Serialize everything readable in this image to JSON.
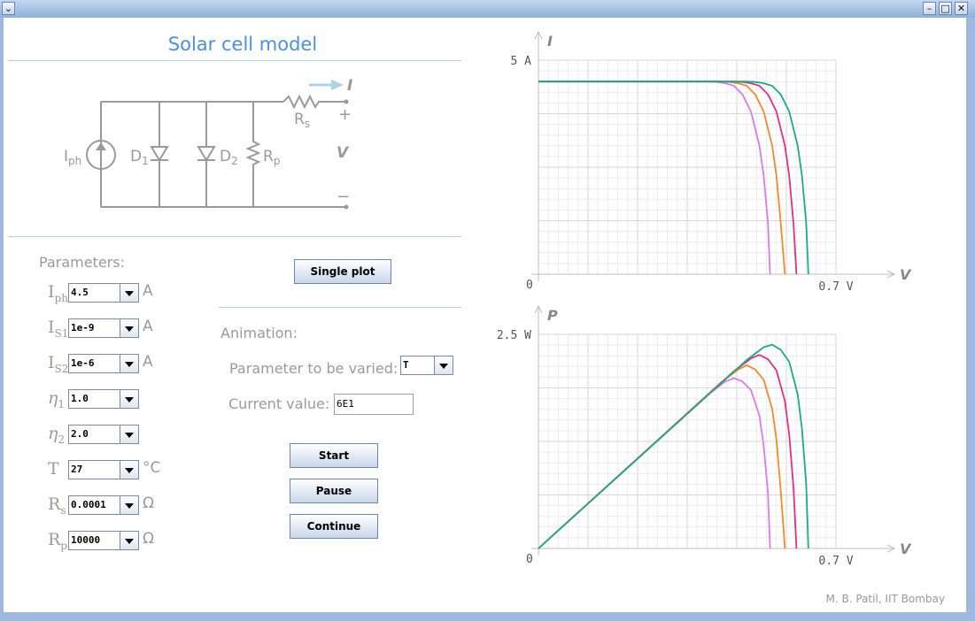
{
  "app": {
    "title": "Solar cell model",
    "credit": "M. B. Patil, IIT Bombay"
  },
  "circuit": {
    "current_label": "I",
    "voltage_label": "V",
    "plus": "+",
    "minus": "−",
    "iph_main": "I",
    "iph_sub": "ph",
    "d1_main": "D",
    "d1_sub": "1",
    "d2_main": "D",
    "d2_sub": "2",
    "rp_main": "R",
    "rp_sub": "p",
    "rs_main": "R",
    "rs_sub": "s"
  },
  "parameters": {
    "heading": "Parameters:",
    "rows": [
      {
        "main": "I",
        "sub": "ph",
        "value": "4.5",
        "unit": "A"
      },
      {
        "main": "I",
        "sub": "S1",
        "value": "1e-9",
        "unit": "A"
      },
      {
        "main": "I",
        "sub": "S2",
        "value": "1e-6",
        "unit": "A"
      },
      {
        "main": "η",
        "sub": "1",
        "value": "1.0",
        "unit": ""
      },
      {
        "main": "η",
        "sub": "2",
        "value": "2.0",
        "unit": ""
      },
      {
        "main": "T",
        "sub": "",
        "value": "27",
        "unit": "°C"
      },
      {
        "main": "R",
        "sub": "s",
        "value": "0.0001",
        "unit": "Ω"
      },
      {
        "main": "R",
        "sub": "p",
        "value": "10000",
        "unit": "Ω"
      }
    ]
  },
  "controls": {
    "single_plot": "Single plot",
    "animation_heading": "Animation:",
    "param_varied_label": "Parameter to be varied:",
    "param_varied_value": "T",
    "current_value_label": "Current value:",
    "current_value": "6E1",
    "start": "Start",
    "pause": "Pause",
    "continue": "Continue"
  },
  "colors": {
    "title": "#4a90e2",
    "series": [
      "#d97be8",
      "#f08a2a",
      "#e0307f",
      "#1aaa8a"
    ]
  },
  "chart_data": [
    {
      "type": "line",
      "ylabel": "I",
      "xlabel": "V",
      "ymax_label": "5 A",
      "xmax_label": "0.7 V",
      "origin_label": "0",
      "xlim": [
        0,
        0.7
      ],
      "ylim": [
        0,
        5
      ],
      "series": [
        {
          "x": [
            0,
            0.4,
            0.42,
            0.44,
            0.46,
            0.48,
            0.5,
            0.52,
            0.53,
            0.54,
            0.545
          ],
          "y": [
            4.5,
            4.5,
            4.49,
            4.46,
            4.4,
            4.2,
            3.8,
            3.0,
            2.3,
            1.2,
            0
          ]
        },
        {
          "x": [
            0,
            0.43,
            0.45,
            0.47,
            0.49,
            0.51,
            0.53,
            0.55,
            0.56,
            0.57,
            0.58
          ],
          "y": [
            4.5,
            4.5,
            4.49,
            4.46,
            4.4,
            4.2,
            3.8,
            3.0,
            2.3,
            1.2,
            0
          ]
        },
        {
          "x": [
            0,
            0.46,
            0.48,
            0.5,
            0.52,
            0.54,
            0.56,
            0.58,
            0.59,
            0.6,
            0.607
          ],
          "y": [
            4.5,
            4.5,
            4.49,
            4.46,
            4.4,
            4.2,
            3.8,
            3.0,
            2.3,
            1.2,
            0
          ]
        },
        {
          "x": [
            0,
            0.49,
            0.51,
            0.53,
            0.55,
            0.57,
            0.59,
            0.61,
            0.62,
            0.63,
            0.635
          ],
          "y": [
            4.5,
            4.5,
            4.49,
            4.46,
            4.4,
            4.2,
            3.8,
            3.0,
            2.3,
            1.2,
            0
          ]
        }
      ]
    },
    {
      "type": "line",
      "ylabel": "P",
      "xlabel": "V",
      "ymax_label": "2.5 W",
      "xmax_label": "0.7 V",
      "origin_label": "0",
      "xlim": [
        0,
        0.7
      ],
      "ylim": [
        0,
        2.5
      ],
      "series": [
        {
          "x": [
            0,
            0.4,
            0.44,
            0.46,
            0.48,
            0.5,
            0.52,
            0.53,
            0.54,
            0.545
          ],
          "y": [
            0,
            1.8,
            1.95,
            1.99,
            1.95,
            1.85,
            1.55,
            1.2,
            0.65,
            0
          ]
        },
        {
          "x": [
            0,
            0.43,
            0.47,
            0.49,
            0.51,
            0.53,
            0.55,
            0.56,
            0.57,
            0.58
          ],
          "y": [
            0,
            1.94,
            2.09,
            2.14,
            2.09,
            1.97,
            1.63,
            1.27,
            0.68,
            0
          ]
        },
        {
          "x": [
            0,
            0.46,
            0.5,
            0.52,
            0.54,
            0.56,
            0.58,
            0.59,
            0.6,
            0.607
          ],
          "y": [
            0,
            2.07,
            2.22,
            2.26,
            2.21,
            2.08,
            1.72,
            1.33,
            0.72,
            0
          ]
        },
        {
          "x": [
            0,
            0.49,
            0.53,
            0.55,
            0.57,
            0.59,
            0.61,
            0.62,
            0.63,
            0.635
          ],
          "y": [
            0,
            2.2,
            2.35,
            2.38,
            2.32,
            2.18,
            1.8,
            1.4,
            0.75,
            0
          ]
        }
      ]
    }
  ]
}
